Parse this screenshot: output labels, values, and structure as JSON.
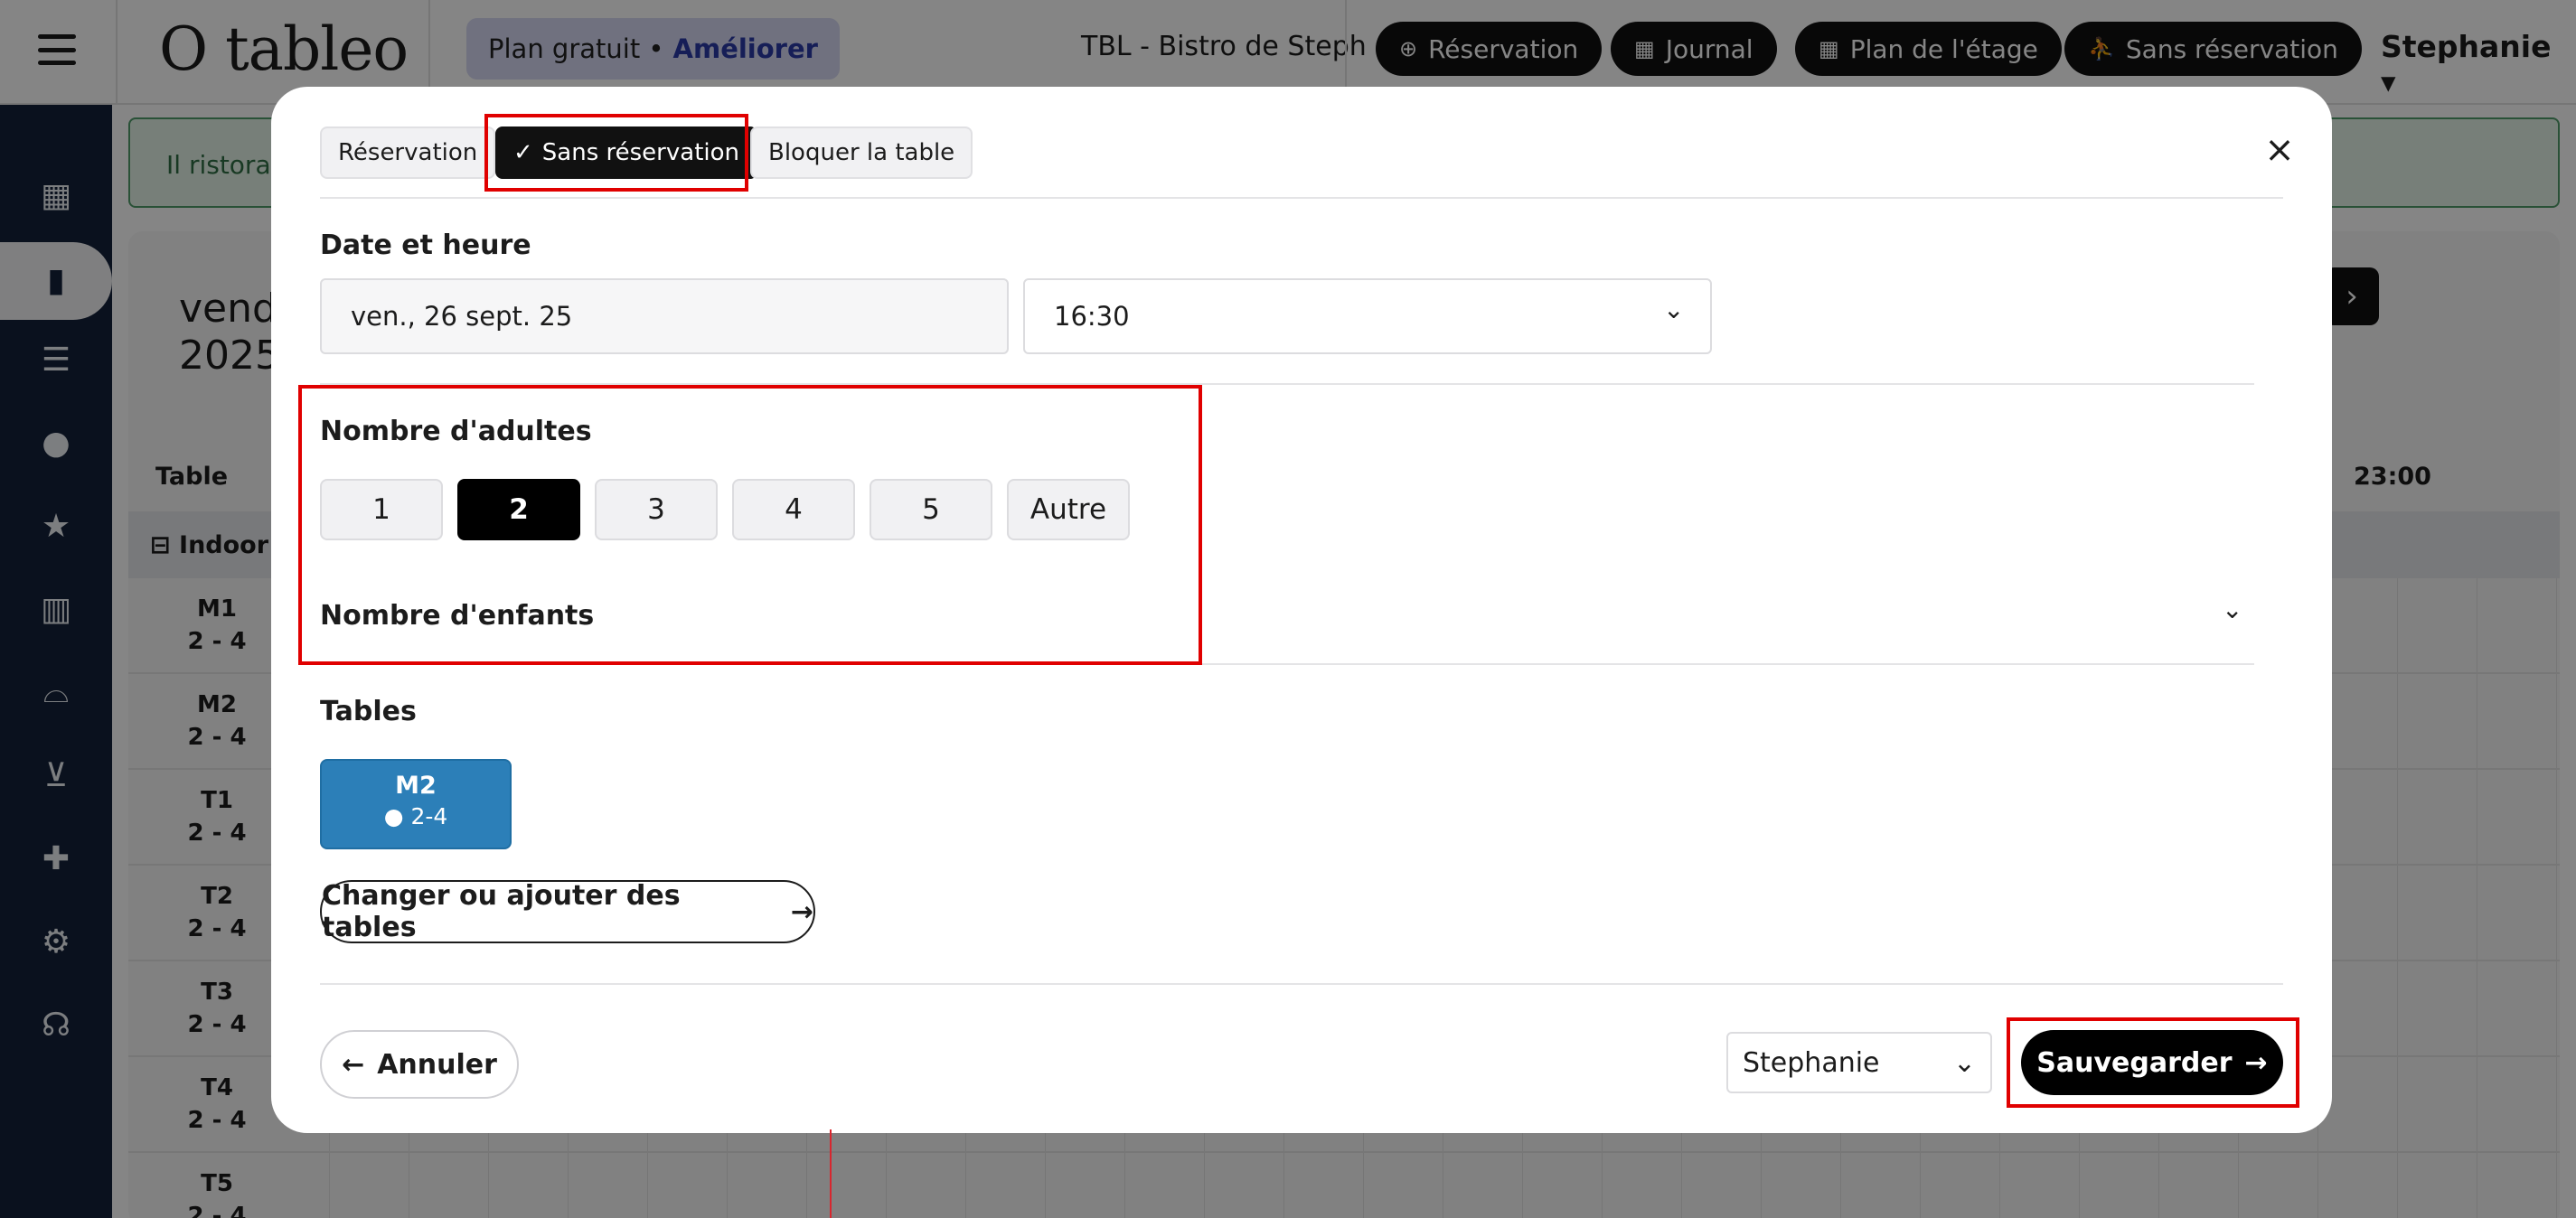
{
  "app": {
    "logo": "O tableo",
    "plan_label": "Plan gratuit •",
    "plan_upgrade": "Améliorer",
    "restaurant": "TBL - Bistro de Steph",
    "user": "Stephanie",
    "nav": [
      {
        "icon": "plus-circle-icon",
        "label": "Réservation"
      },
      {
        "icon": "calendar-icon",
        "label": "Journal"
      },
      {
        "icon": "calendar-icon",
        "label": "Plan de l'étage"
      },
      {
        "icon": "walk-icon",
        "label": "Sans réservation"
      }
    ]
  },
  "background": {
    "alert_text": "Il ristorante",
    "date_line1": "vendr",
    "date_line2": "2025",
    "col_table": "Table",
    "col_time": "23:00",
    "section": "Indoor",
    "tables": [
      {
        "name": "M1",
        "cap": "2 - 4"
      },
      {
        "name": "M2",
        "cap": "2 - 4"
      },
      {
        "name": "T1",
        "cap": "2 - 4"
      },
      {
        "name": "T2",
        "cap": "2 - 4"
      },
      {
        "name": "T3",
        "cap": "2 - 4"
      },
      {
        "name": "T4",
        "cap": "2 - 4"
      },
      {
        "name": "T5",
        "cap": "2 - 4"
      }
    ]
  },
  "modal": {
    "tabs": [
      "Réservation",
      "Sans réservation",
      "Bloquer la table"
    ],
    "active_tab": "Sans réservation",
    "date_time_label": "Date et heure",
    "date_value": "ven., 26 sept. 25",
    "time_value": "16:30",
    "adults_label": "Nombre d'adultes",
    "adult_options": [
      "1",
      "2",
      "3",
      "4",
      "5",
      "Autre"
    ],
    "selected_adults": "2",
    "children_label": "Nombre d'enfants",
    "tables_label": "Tables",
    "selected_table": {
      "name": "M2",
      "capacity": "2-4"
    },
    "change_tables_label": "Changer ou ajouter des tables",
    "cancel_label": "Annuler",
    "staff_select": "Stephanie",
    "save_label": "Sauvegarder"
  },
  "colors": {
    "sidebar": "#14213a",
    "accent_table": "#2c7fb8",
    "highlight": "#e00000",
    "primary_button": "#000000"
  }
}
